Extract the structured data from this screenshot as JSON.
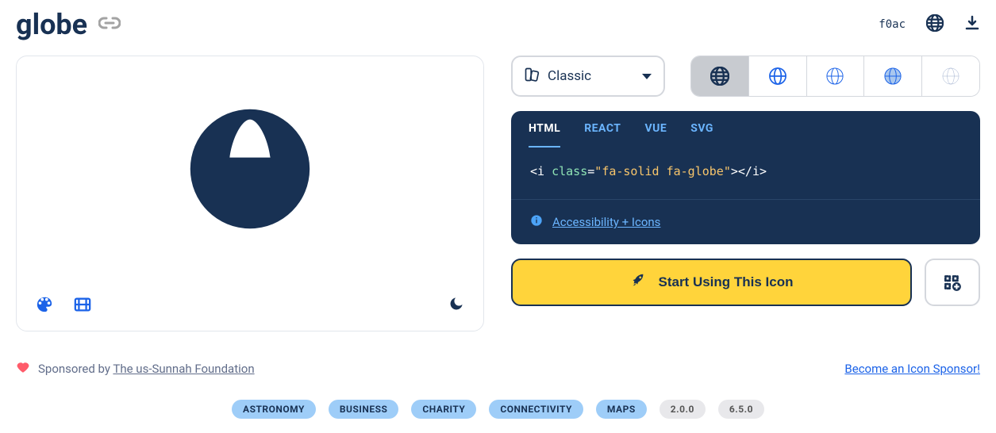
{
  "header": {
    "title": "globe",
    "unicode": "f0ac"
  },
  "family_select": {
    "label": "Classic"
  },
  "variants": [
    {
      "style": "solid",
      "active": true
    },
    {
      "style": "regular",
      "active": false
    },
    {
      "style": "light",
      "active": false
    },
    {
      "style": "thin",
      "active": false
    },
    {
      "style": "duotone",
      "active": false
    }
  ],
  "code_tabs": [
    "HTML",
    "REACT",
    "VUE",
    "SVG"
  ],
  "code_active_tab": "HTML",
  "code_snippet": {
    "open_lt": "<",
    "tag": "i",
    "attr_name": "class",
    "attr_value": "fa-solid fa-globe",
    "close": "></i>"
  },
  "accessibility_link": "Accessibility + Icons",
  "cta_label": "Start Using This Icon",
  "sponsor": {
    "prefix": "Sponsored by ",
    "name": "The us-Sunnah Foundation",
    "become": "Become an Icon Sponsor!"
  },
  "tags": [
    "ASTRONOMY",
    "BUSINESS",
    "CHARITY",
    "CONNECTIVITY",
    "MAPS"
  ],
  "versions": [
    "2.0.0",
    "6.5.0"
  ]
}
